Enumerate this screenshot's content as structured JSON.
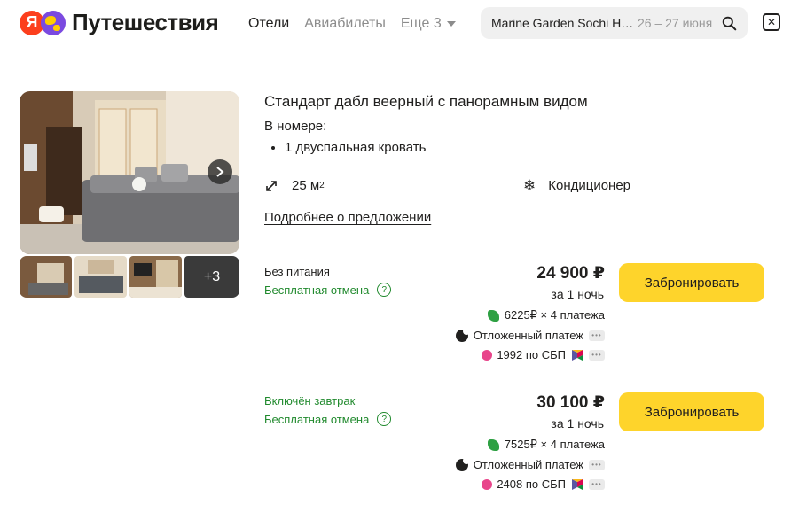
{
  "brand": {
    "ya_letter": "Я",
    "name": "Путешествия"
  },
  "nav": {
    "hotels": "Отели",
    "flights": "Авиабилеты",
    "more": "Еще 3"
  },
  "search": {
    "hotel": "Marine Garden Sochi Ho…",
    "dates": "26 – 27 июня"
  },
  "gallery": {
    "more_count": "+3"
  },
  "room": {
    "title": "Стандарт дабл веерный с панорамным видом",
    "in_room_heading": "В номере:",
    "bed": "1 двуспальная кровать",
    "area_value": "25 м",
    "area_sup": "2",
    "amenity": "Кондиционер",
    "details_link": "Подробнее о предложении"
  },
  "offers": [
    {
      "meal": "Без питания",
      "cancellation": "Бесплатная отмена",
      "price": "24 900 ₽",
      "per_night": "за 1 ночь",
      "split": "6225₽ × 4 платежа",
      "deferred": "Отложенный платеж",
      "sbp": "1992 по СБП",
      "button": "Забронировать"
    },
    {
      "meal": "Включён завтрак",
      "cancellation": "Бесплатная отмена",
      "price": "30 100 ₽",
      "per_night": "за 1 ночь",
      "split": "7525₽ × 4 платежа",
      "deferred": "Отложенный платеж",
      "sbp": "2408 по СБП",
      "button": "Забронировать"
    }
  ],
  "colors": {
    "accent_yellow": "#fed42b",
    "green": "#218a2e",
    "brand_red": "#fc3f1d"
  }
}
